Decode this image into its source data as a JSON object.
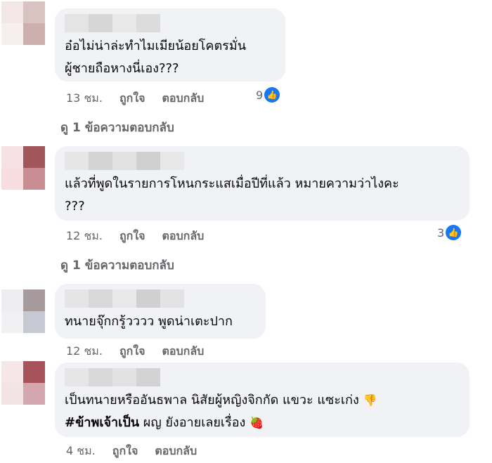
{
  "comments": [
    {
      "lines": [
        "อ๋อไม่น่าล่ะทำไมเมียน้อยโคตรมั่น",
        "ผู้ชายถือหางนี่เอง???"
      ],
      "time": "13 ชม.",
      "like_label": "ถูกใจ",
      "reply_label": "ตอบกลับ",
      "reaction_count": "9",
      "view_replies": "ดู 1 ข้อความตอบกลับ"
    },
    {
      "lines": [
        "แล้วที่พูดในรายการโหนกระแสเมื่อปีที่แล้ว หมายความว่าไงคะ",
        "???"
      ],
      "time": "12 ชม.",
      "like_label": "ถูกใจ",
      "reply_label": "ตอบกลับ",
      "reaction_count": "3",
      "view_replies": "ดู 1 ข้อความตอบกลับ"
    },
    {
      "lines": [
        "ทนายจุ๊กกรู้วววว พูดน่าเตะปาก"
      ],
      "time": "12 ชม.",
      "like_label": "ถูกใจ",
      "reply_label": "ตอบกลับ"
    },
    {
      "line1": "เป็นทนายหรืออันธพาล นิสัยผู้หญิงจิกกัด แขวะ แซะเก่ง",
      "line1_emoji": "👎",
      "hashtag": "#ข้าพเจ้าเป็น",
      "line2_rest": " ผญ ยังอายเลยเรื่อง",
      "line2_emoji": "🍓",
      "time": "4 ชม.",
      "like_label": "ถูกใจ",
      "reply_label": "ตอบกลับ"
    }
  ],
  "colors": {
    "bubble": "#f0f2f5",
    "meta": "#65676b",
    "like_blue": "#1877f2"
  },
  "icons": {
    "reaction": "like-thumb-icon"
  }
}
